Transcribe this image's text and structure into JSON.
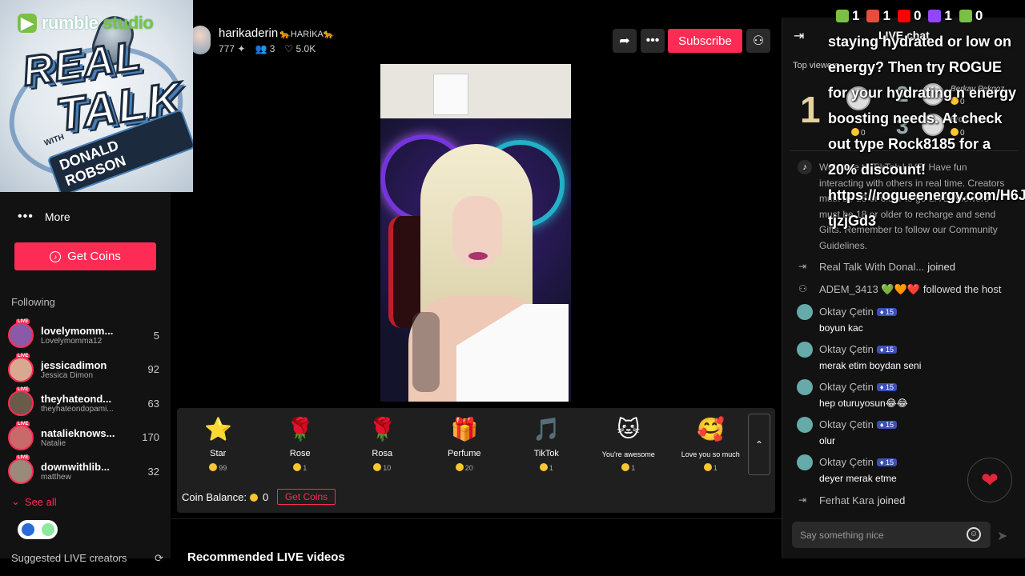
{
  "overlay": {
    "branding": {
      "rumble": "rumble",
      "studio": "studio",
      "line1": "REAL",
      "line2": "TALK",
      "with": "WITH",
      "host": "DONALD ROBSON"
    },
    "stats": [
      {
        "icon": "rumble-icon",
        "value": "1",
        "color": "#7ac143"
      },
      {
        "icon": "users-icon",
        "value": "1",
        "color": "#e84c3d"
      },
      {
        "icon": "youtube-icon",
        "value": "0",
        "color": "#ff0000"
      },
      {
        "icon": "twitch-icon",
        "value": "1",
        "color": "#9146ff"
      },
      {
        "icon": "link-icon",
        "value": "0",
        "color": "#7ac143"
      }
    ],
    "promo_text": "staying hydrated or low on energy? Then try ROGUE for your hydrating n energy boosting needs. At check out type Rock8185 for a 20% discount! https://rogueenergy.com/H6JwS-tjzjGd3"
  },
  "sidebar": {
    "more_label": "More",
    "get_coins_label": "Get Coins",
    "following_heading": "Following",
    "following": [
      {
        "name": "lovelymomm...",
        "sub": "Lovelymomma12",
        "count": "5",
        "live": "LIVE",
        "avatar_color": "#8a5aa8"
      },
      {
        "name": "jessicadimon",
        "sub": "Jessica Dimon",
        "count": "92",
        "live": "LIVE",
        "avatar_color": "#d8a890"
      },
      {
        "name": "theyhateond...",
        "sub": "theyhateondopami...",
        "count": "63",
        "live": "LIVE",
        "avatar_color": "#6a5a4a"
      },
      {
        "name": "natalieknows...",
        "sub": "Natalie",
        "count": "170",
        "live": "LIVE",
        "avatar_color": "#c86a6a"
      },
      {
        "name": "downwithlib...",
        "sub": "matthew",
        "count": "32",
        "live": "LIVE",
        "avatar_color": "#9a8a7a"
      }
    ],
    "see_all_label": "See all",
    "suggested_label": "Suggested LIVE creators"
  },
  "host": {
    "username": "harikaderin",
    "display_tag": "🐆HARİKA🐆",
    "likes": "777",
    "viewers": "3",
    "hearts": "5.0K",
    "subscribe_label": "Subscribe"
  },
  "gifts": [
    {
      "icon": "⭐",
      "name": "Star",
      "price": "99"
    },
    {
      "icon": "🌹",
      "name": "Rose",
      "price": "1"
    },
    {
      "icon": "🌹",
      "name": "Rosa",
      "price": "10"
    },
    {
      "icon": "🎁",
      "name": "Perfume",
      "price": "20"
    },
    {
      "icon": "🎵",
      "name": "TikTok",
      "price": "1"
    },
    {
      "icon": "🐱",
      "name": "You're awesome",
      "price": "1"
    },
    {
      "icon": "🥰",
      "name": "Love you so much",
      "price": "1"
    }
  ],
  "wallet": {
    "coin_balance_label": "Coin Balance:",
    "coin_balance_value": "0",
    "get_coins_label": "Get Coins"
  },
  "recommended_label": "Recommended LIVE videos",
  "chat": {
    "title": "LIVE chat",
    "top_viewers_label": "Top viewers",
    "top_viewers": [
      {
        "rank": "1",
        "name": "",
        "coins": "0"
      },
      {
        "rank": "2",
        "name": "Berkay Pekgoz",
        "coins": "0"
      },
      {
        "rank": "3",
        "name": "Erce Li Ge...",
        "coins": "0"
      }
    ],
    "welcome_text": "Welcome to TikTok LIVE! Have fun interacting with others in real time. Creators must be 18 or older to go LIVE. Viewers must be 18 or older to recharge and send Gifts. Remember to follow our Community Guidelines.",
    "messages": [
      {
        "type": "joined",
        "user": "Real Talk With Donal...",
        "action": "joined"
      },
      {
        "type": "followed",
        "user": "ADEM_3413 💚🧡❤️",
        "action": "followed the host"
      },
      {
        "type": "comment",
        "user": "Oktay Çetin",
        "badge": "15",
        "text": "boyun kac"
      },
      {
        "type": "comment",
        "user": "Oktay Çetin",
        "badge": "15",
        "text": "merak etim boydan seni"
      },
      {
        "type": "comment",
        "user": "Oktay Çetin",
        "badge": "15",
        "text": "hep oturuyosun😂😂"
      },
      {
        "type": "comment",
        "user": "Oktay Çetin",
        "badge": "15",
        "text": "olur"
      },
      {
        "type": "comment",
        "user": "Oktay Çetin",
        "badge": "15",
        "text": "deyer merak etme"
      },
      {
        "type": "joined",
        "user": "Ferhat Kara",
        "action": "joined"
      }
    ],
    "input_placeholder": "Say something nice"
  }
}
